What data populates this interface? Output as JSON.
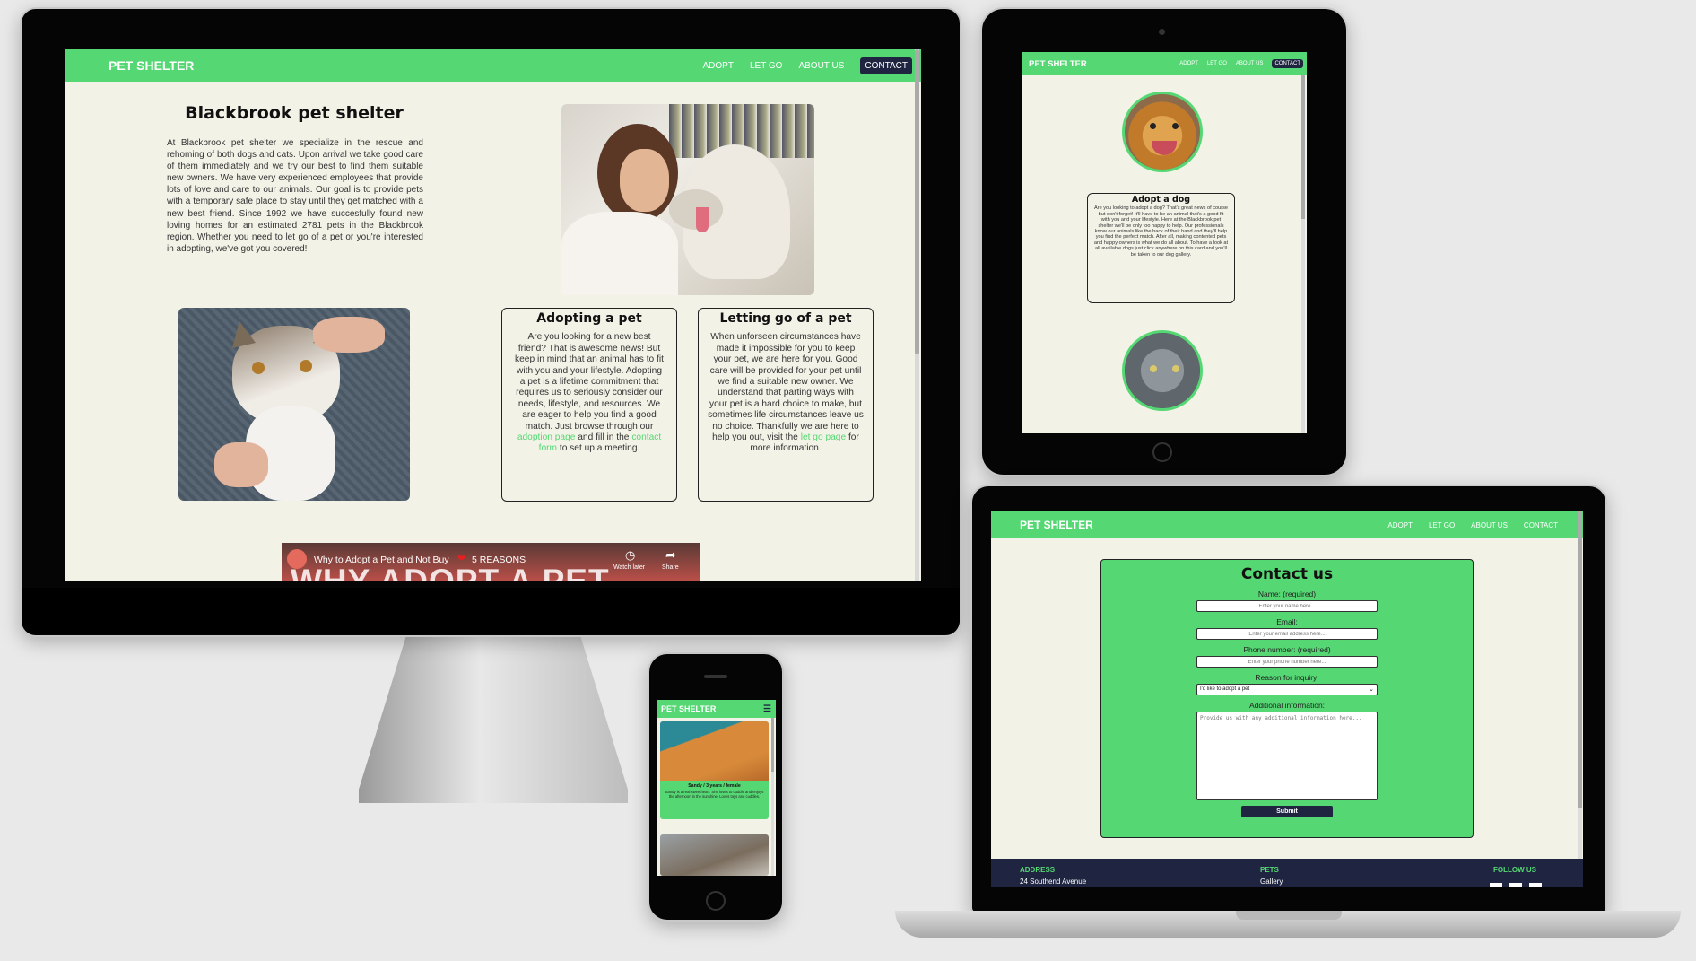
{
  "brand": "PET SHELTER",
  "nav": {
    "adopt": "ADOPT",
    "let_go": "LET GO",
    "about": "ABOUT US",
    "contact": "CONTACT"
  },
  "desktop": {
    "title": "Blackbrook pet shelter",
    "intro": "At Blackbrook pet shelter we specialize in the rescue and rehoming of both dogs and cats. Upon arrival we take good care of them immediately and we try our best to find them suitable new owners. We have very experienced employees that provide lots of love and care to our animals. Our goal is to provide pets with a temporary safe place to stay until they get matched with a new best friend. Since 1992 we have succesfully found new loving homes for an estimated 2781 pets in the Blackbrook region. Whether you need to let go of a pet or you're interested in adopting, we've got you covered!",
    "adopt_card": {
      "title": "Adopting a pet",
      "text": "Are you looking for a new best friend? That is awesome news! But keep in mind that an animal has to fit with you and your lifestyle. Adopting a pet is a lifetime commitment that requires us to seriously consider our needs, lifestyle, and resources. We are eager to help you find a good match. Just browse through our",
      "link1": "adoption page",
      "mid": "and fill in the",
      "link2": "contact form",
      "end": "to set up a meeting."
    },
    "letgo_card": {
      "title": "Letting go of a pet",
      "text": "When unforseen circumstances have made it impossible for you to keep your pet, we are here for you. Good care will be provided for your pet until we find a suitable new owner. We understand that parting ways with your pet is a hard choice to make, but sometimes life circumstances leave us no choice. Thankfully we are here to help you out, visit the",
      "link": "let go page",
      "end": "for more information."
    },
    "video": {
      "title": "Why to Adopt a Pet and Not Buy",
      "reasons": "5 REASONS",
      "overlay": "WHY ADOPT A PET",
      "watch_later": "Watch later",
      "share": "Share"
    }
  },
  "tablet": {
    "card_title": "Adopt a dog",
    "card_text": "Are you looking to adopt a dog? That's great news of course but don't forget! It'll have to be an animal that's a good fit with you and your lifestyle. Here at the Blackbrook pet shelter we'll be only too happy to help. Our professionals know our animals like the back of their hand and they'll help you find the perfect match. After all, making contented pets and happy owners is what we do all about. To have a look at all available dogs just click anywhere on this card and you'll be taken to our dog gallery."
  },
  "laptop": {
    "form_title": "Contact us",
    "name_label": "Name: (required)",
    "name_placeholder": "Enter your name here...",
    "email_label": "Email:",
    "email_placeholder": "Enter your email address here...",
    "phone_label": "Phone number: (required)",
    "phone_placeholder": "Enter your phone number here...",
    "reason_label": "Reason for inquiry:",
    "reason_value": "I'd like to adopt a pet",
    "info_label": "Additional information:",
    "info_placeholder": "Provide us with any additional information here...",
    "submit": "Submit",
    "footer": {
      "address": "ADDRESS",
      "address_line": "24 Southend Avenue",
      "pets": "PETS",
      "gallery": "Gallery",
      "follow": "FOLLOW US"
    }
  },
  "phone": {
    "caption": "Sandy / 3 years / female",
    "text": "Sandy is a real sweetheart. She loves to cuddle and enjoys the afternoon in the sunshine. Loves toys and cuddles."
  },
  "colors": {
    "accent": "#55d874",
    "dark": "#1f2540",
    "page_bg": "#f3f2e7"
  },
  "icons": [
    "hamburger-icon",
    "watch-later-icon",
    "share-icon",
    "youtube-avatar-icon"
  ]
}
